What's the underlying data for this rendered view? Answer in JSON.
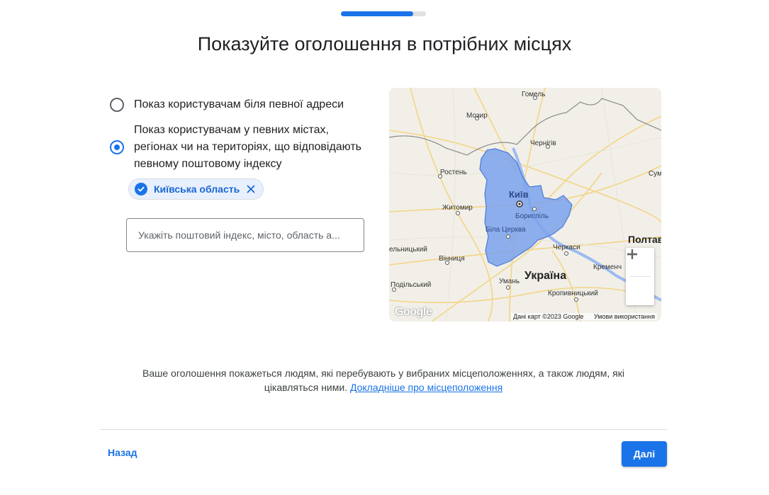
{
  "progress": {
    "fraction": 0.85
  },
  "title": "Показуйте оголошення в потрібних місцях",
  "options": [
    {
      "label": "Показ користувачам біля певної адреси",
      "selected": false
    },
    {
      "label_lines": [
        "Показ користувачам у певних містах,",
        "регіонах чи на територіях, що відповідають",
        "певному поштовому індексу"
      ],
      "selected": true
    }
  ],
  "selected_location": {
    "label": "Київська область"
  },
  "search": {
    "placeholder": "Укажіть поштовий індекс, місто, область а...",
    "value": ""
  },
  "map": {
    "region_color": "#4285f4",
    "labels": {
      "gomel": "Гомель",
      "mozyr": "Мозир",
      "chernihiv": "Чернігів",
      "rivne": "Ростень",
      "zhytomyr": "Житомир",
      "kyiv": "Київ",
      "boryspil": "Бориспіль",
      "bila_tserkva": "Біла Церква",
      "vinnytsia": "Вінниця",
      "cherkasy": "Черкаси",
      "kremenchuk": "Кременч",
      "poltava": "Полтав",
      "sumy": "Сум",
      "uman": "Умань",
      "ukraine": "Україна",
      "khmelnytskyi": "ельницький",
      "podilskyi": "Подільський",
      "kropyvnytskyi": "Кропивницький"
    },
    "google": "Google",
    "attribution": "Дані карт ©2023 Google",
    "terms": "Умови використання"
  },
  "note": {
    "line1": "Ваше оголошення покажеться людям, які перебувають у вибраних місцеположеннях, а також людям, які",
    "line2": "цікавляться ними.",
    "link": "Докладніше про місцеположення"
  },
  "buttons": {
    "back": "Назад",
    "next": "Далі"
  },
  "colors": {
    "accent": "#1a73e8",
    "chip_bg": "#e8f0fe"
  },
  "icons": {
    "chip_check": "check-circle-icon",
    "chip_remove": "close-icon",
    "zoom_in": "plus-icon",
    "zoom_out": "minus-icon"
  }
}
